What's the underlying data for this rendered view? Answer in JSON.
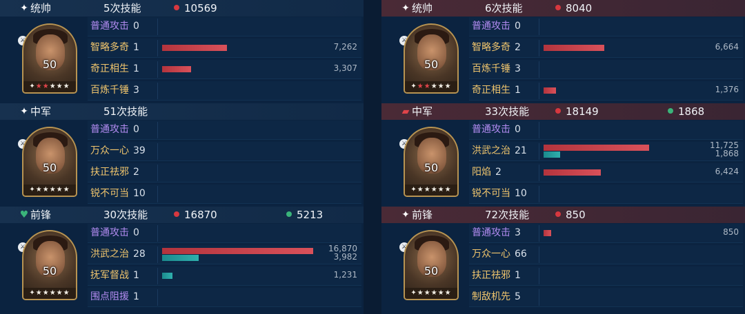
{
  "left": {
    "blocks": [
      {
        "role": "统帅",
        "badge_icon": "✦",
        "skills_count": "5次技能",
        "damage": "10569",
        "heal": null,
        "level": "50",
        "rows": [
          {
            "name": "普通攻击",
            "count": "0",
            "style": "basic"
          },
          {
            "name": "智略多奇",
            "count": "1",
            "style": "alt",
            "red": 0.43,
            "red_value": "7,262"
          },
          {
            "name": "奇正相生",
            "count": "1",
            "style": "alt",
            "red": 0.19,
            "red_value": "3,307"
          },
          {
            "name": "百炼千锤",
            "count": "3",
            "style": "alt"
          }
        ]
      },
      {
        "role": "中军",
        "badge_icon": "✦",
        "skills_count": "51次技能",
        "damage": null,
        "heal": null,
        "level": "50",
        "rows": [
          {
            "name": "普通攻击",
            "count": "0",
            "style": "basic"
          },
          {
            "name": "万众一心",
            "count": "39",
            "style": "alt"
          },
          {
            "name": "扶正祛邪",
            "count": "2",
            "style": "alt"
          },
          {
            "name": "锐不可当",
            "count": "10",
            "style": "alt"
          }
        ]
      },
      {
        "role": "前锋",
        "badge_icon": "♥",
        "skills_count": "30次技能",
        "damage": "16870",
        "heal": "5213",
        "level": "50",
        "rows": [
          {
            "name": "普通攻击",
            "count": "0",
            "style": "basic"
          },
          {
            "name": "洪武之治",
            "count": "28",
            "style": "alt",
            "red": 1.0,
            "red_value": "16,870",
            "teal": 0.24,
            "teal_value": "3,982"
          },
          {
            "name": "抚军督战",
            "count": "1",
            "style": "alt",
            "teal": 0.07,
            "teal_value": "1,231"
          },
          {
            "name": "围点阻援",
            "count": "1",
            "style": "basic"
          }
        ]
      }
    ]
  },
  "right": {
    "blocks": [
      {
        "role": "统帅",
        "badge_icon": "✦",
        "skills_count": "6次技能",
        "damage": "8040",
        "heal": null,
        "level": "50",
        "rows": [
          {
            "name": "普通攻击",
            "count": "0",
            "style": "basic"
          },
          {
            "name": "智略多奇",
            "count": "2",
            "style": "alt",
            "red": 0.4,
            "red_value": "6,664"
          },
          {
            "name": "百炼千锤",
            "count": "3",
            "style": "alt"
          },
          {
            "name": "奇正相生",
            "count": "1",
            "style": "alt",
            "red": 0.08,
            "red_value": "1,376"
          }
        ]
      },
      {
        "role": "中军",
        "badge_icon": "▰",
        "skills_count": "33次技能",
        "damage": "18149",
        "heal": "1868",
        "level": "50",
        "rows": [
          {
            "name": "普通攻击",
            "count": "0",
            "style": "basic"
          },
          {
            "name": "洪武之治",
            "count": "21",
            "style": "alt",
            "red": 0.7,
            "red_value": "11,725",
            "teal": 0.11,
            "teal_value": "1,868"
          },
          {
            "name": "阳焰",
            "count": "2",
            "style": "alt",
            "red": 0.38,
            "red_value": "6,424"
          },
          {
            "name": "锐不可当",
            "count": "10",
            "style": "alt"
          }
        ]
      },
      {
        "role": "前锋",
        "badge_icon": "✦",
        "skills_count": "72次技能",
        "damage": "850",
        "heal": null,
        "level": "50",
        "rows": [
          {
            "name": "普通攻击",
            "count": "3",
            "style": "basic",
            "red": 0.05,
            "red_value": "850"
          },
          {
            "name": "万众一心",
            "count": "66",
            "style": "alt"
          },
          {
            "name": "扶正祛邪",
            "count": "1",
            "style": "alt"
          },
          {
            "name": "制敌机先",
            "count": "5",
            "style": "alt"
          }
        ]
      }
    ]
  },
  "colors": {
    "panel_bg": "#0b2340",
    "ally_header": "#17314f",
    "enemy_header": "#4a2a36",
    "damage_bar": "#d9515a",
    "heal_bar": "#2fb0ad",
    "basic_attack_text": "#b38cf2",
    "skill_text": "#f0c56d"
  },
  "icons": {
    "role_badge": "sparkle-icon",
    "vanguard_badge": "heart-gem-icon",
    "weapon": "sword-icon",
    "damage_dot": "red-dot-icon",
    "heal_dot": "green-dot-icon"
  }
}
